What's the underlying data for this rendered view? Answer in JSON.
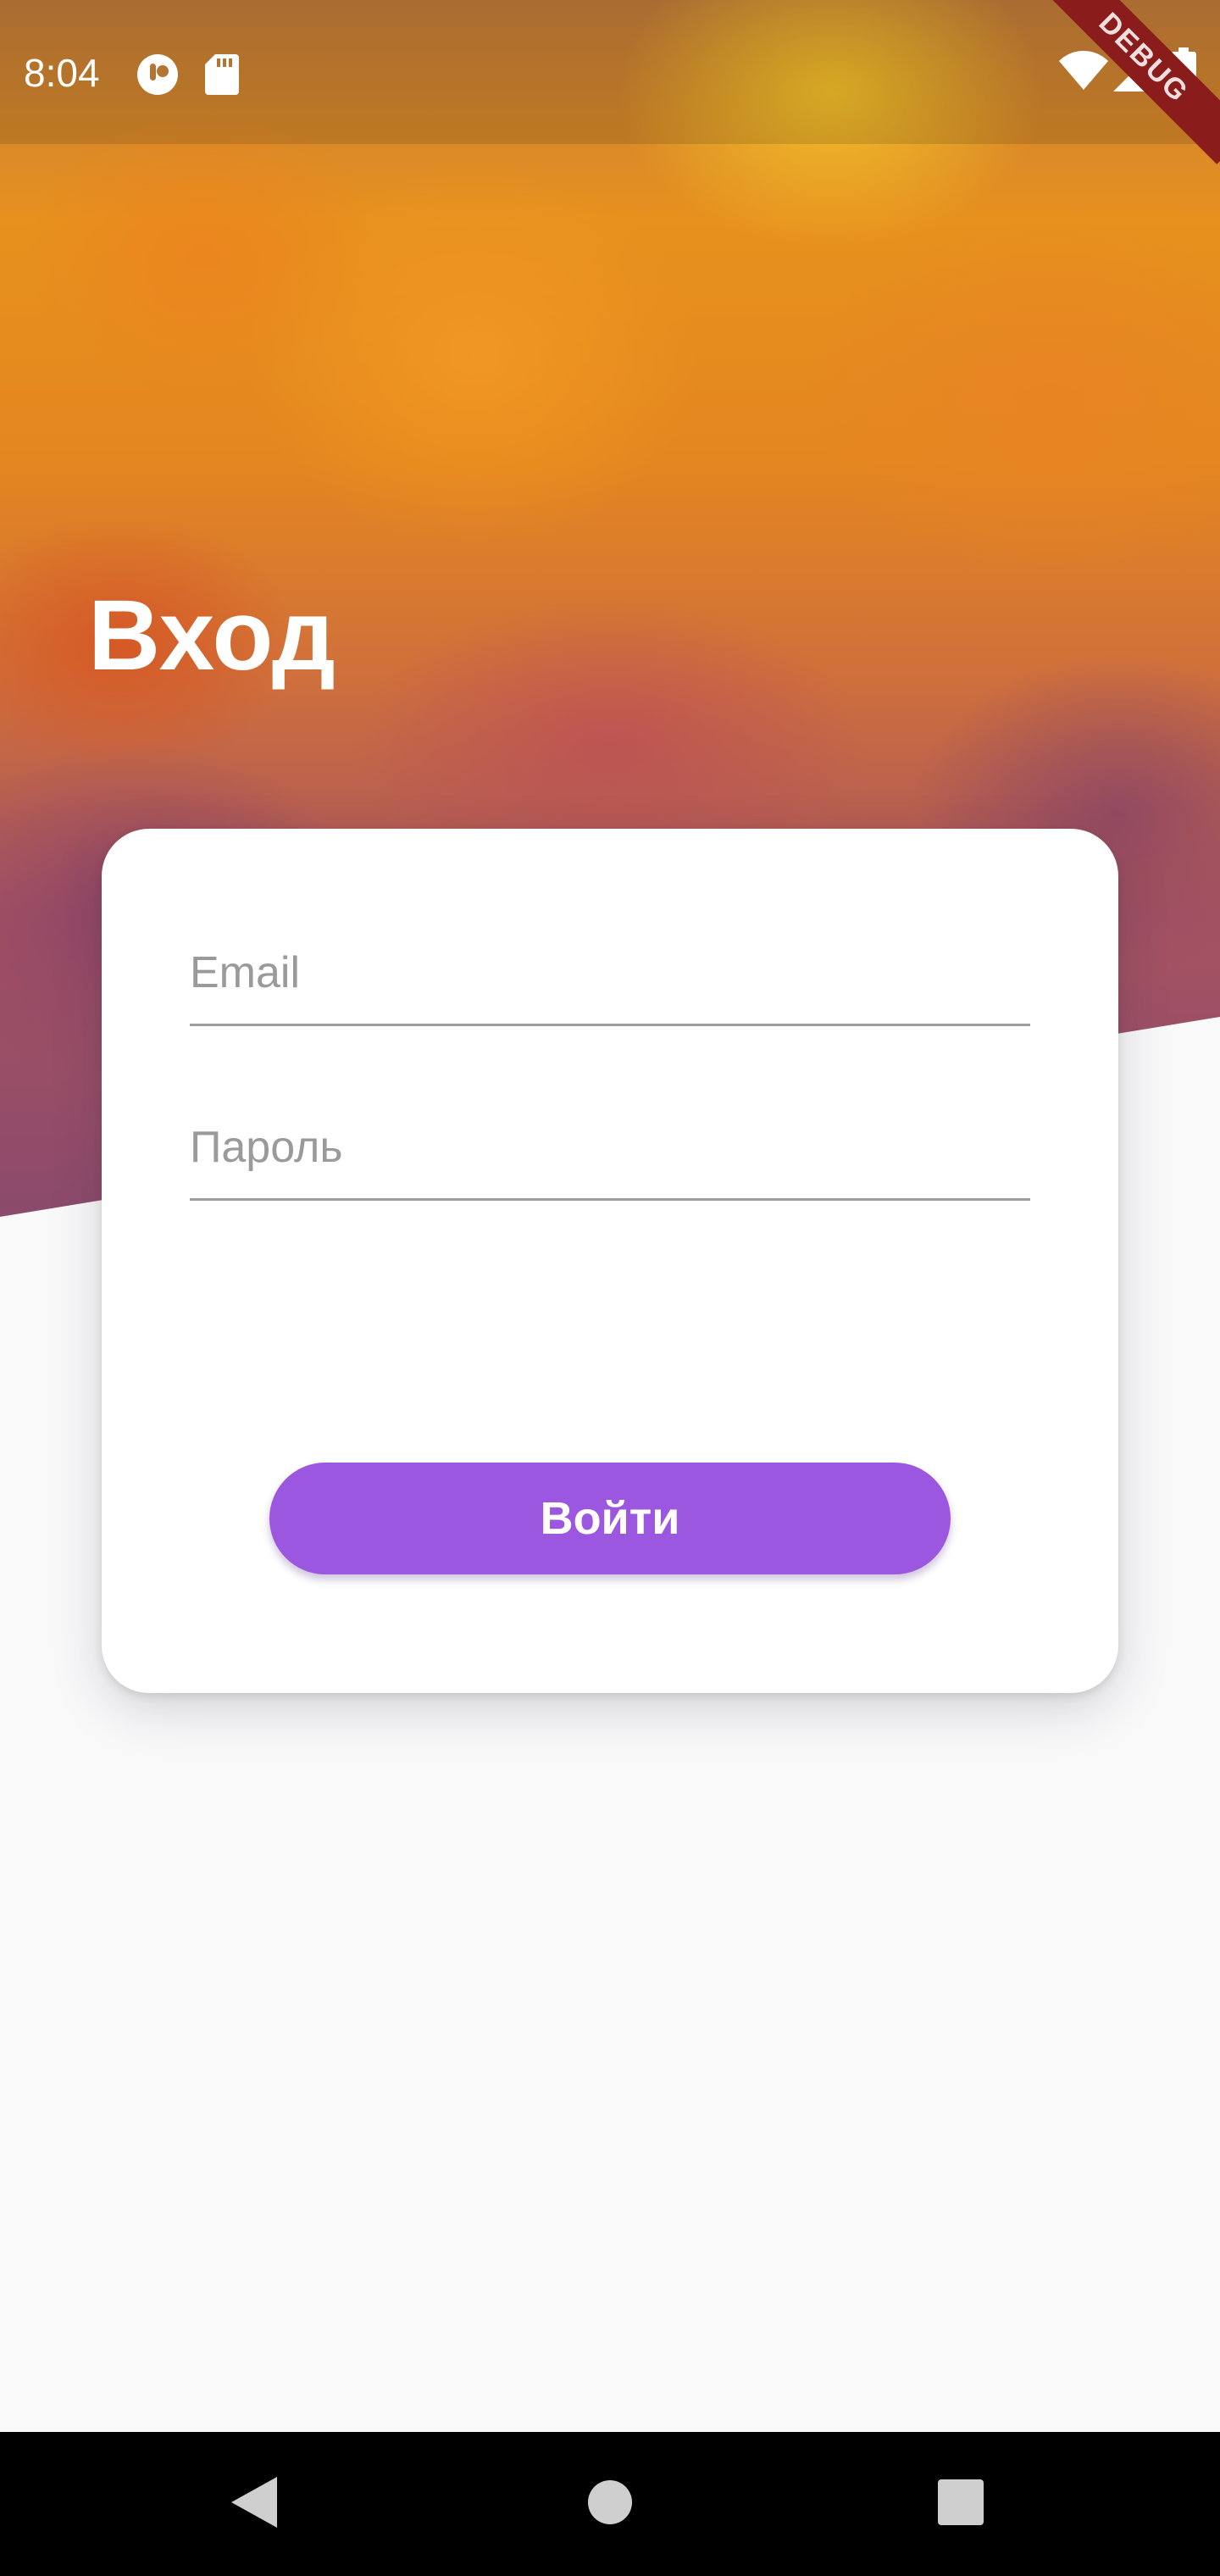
{
  "status_bar": {
    "time": "8:04",
    "debug_label": "DEBUG"
  },
  "screen": {
    "title": "Вход"
  },
  "login_form": {
    "email_placeholder": "Email",
    "password_placeholder": "Пароль",
    "submit_label": "Войти"
  },
  "colors": {
    "button": "#9b57e0",
    "background": "#f9f9fa",
    "navigation_bar": "#000000",
    "debug_ribbon": "#8b1c1c"
  },
  "icons": {
    "status": [
      "app-notification-icon",
      "sd-card-icon",
      "wifi-icon",
      "signal-icon",
      "battery-icon"
    ],
    "navigation": [
      "back-icon",
      "home-icon",
      "recents-icon"
    ]
  }
}
